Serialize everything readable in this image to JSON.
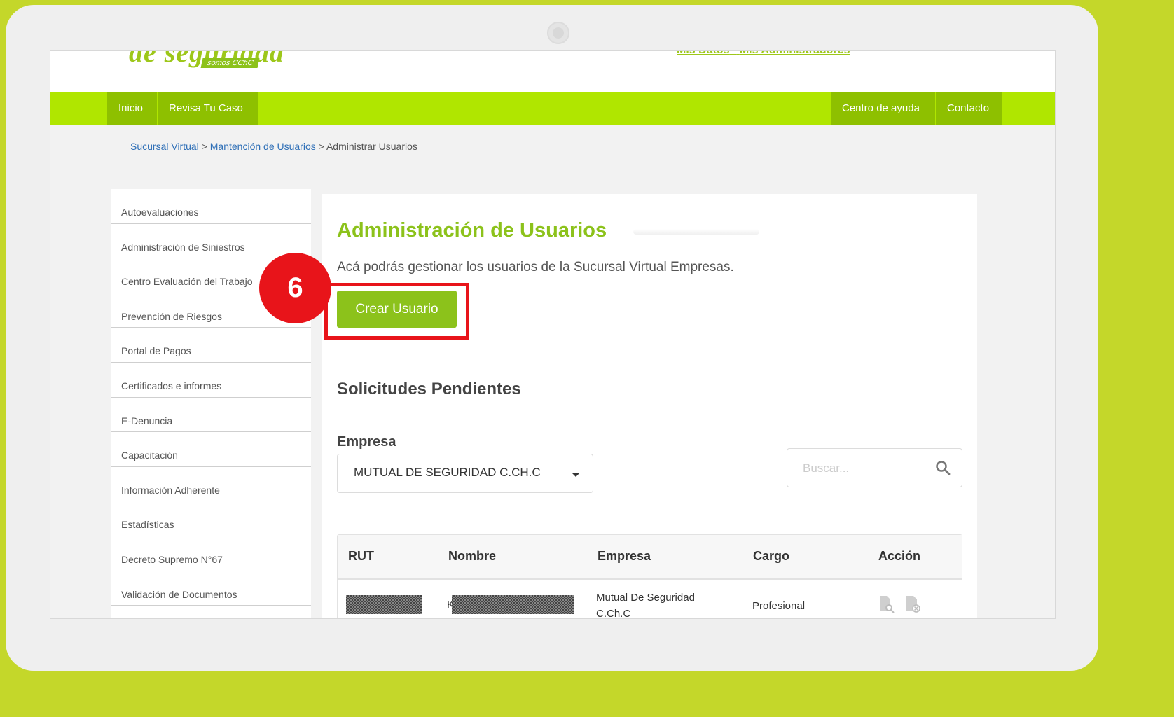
{
  "header": {
    "logo_top": "de seguridad",
    "logo_badge": "somos CChC",
    "links": [
      "Mis Datos",
      "-",
      "Mis Administradores"
    ]
  },
  "nav": {
    "left": [
      "Inicio",
      "Revisa Tu Caso"
    ],
    "right": [
      "Centro de ayuda",
      "Contacto"
    ]
  },
  "breadcrumb": {
    "items": [
      "Sucursal Virtual",
      "Mantención de Usuarios",
      "Administrar Usuarios"
    ],
    "separator": ">"
  },
  "sidebar": {
    "items": [
      "Autoevaluaciones",
      "Administración de Siniestros",
      "Centro Evaluación del Trabajo",
      "Prevención de Riesgos",
      "Portal de Pagos",
      "Certificados e informes",
      "E-Denuncia",
      "Capacitación",
      "Información Adherente",
      "Estadísticas",
      "Decreto Supremo N°67",
      "Validación de Documentos"
    ]
  },
  "main": {
    "title": "Administración de Usuarios",
    "subtitle": "Acá podrás gestionar los usuarios de la Sucursal Virtual Empresas.",
    "create_button": "Crear Usuario",
    "step_number": "6",
    "section_title": "Solicitudes Pendientes",
    "empresa_label": "Empresa",
    "empresa_selected": "MUTUAL DE SEGURIDAD C.CH.C",
    "search_placeholder": "Buscar..."
  },
  "table": {
    "headers": [
      "RUT",
      "Nombre",
      "Empresa",
      "Cargo",
      "Acción"
    ],
    "row": {
      "rut": "",
      "nombre_prefix": "K",
      "empresa": "Mutual De Seguridad C.Ch.C",
      "cargo": "Profesional"
    }
  },
  "colors": {
    "brand_green": "#8cc21b",
    "nav_bar": "#b0e600",
    "highlight_red": "#e8141a",
    "frame": "#c4d72a"
  }
}
